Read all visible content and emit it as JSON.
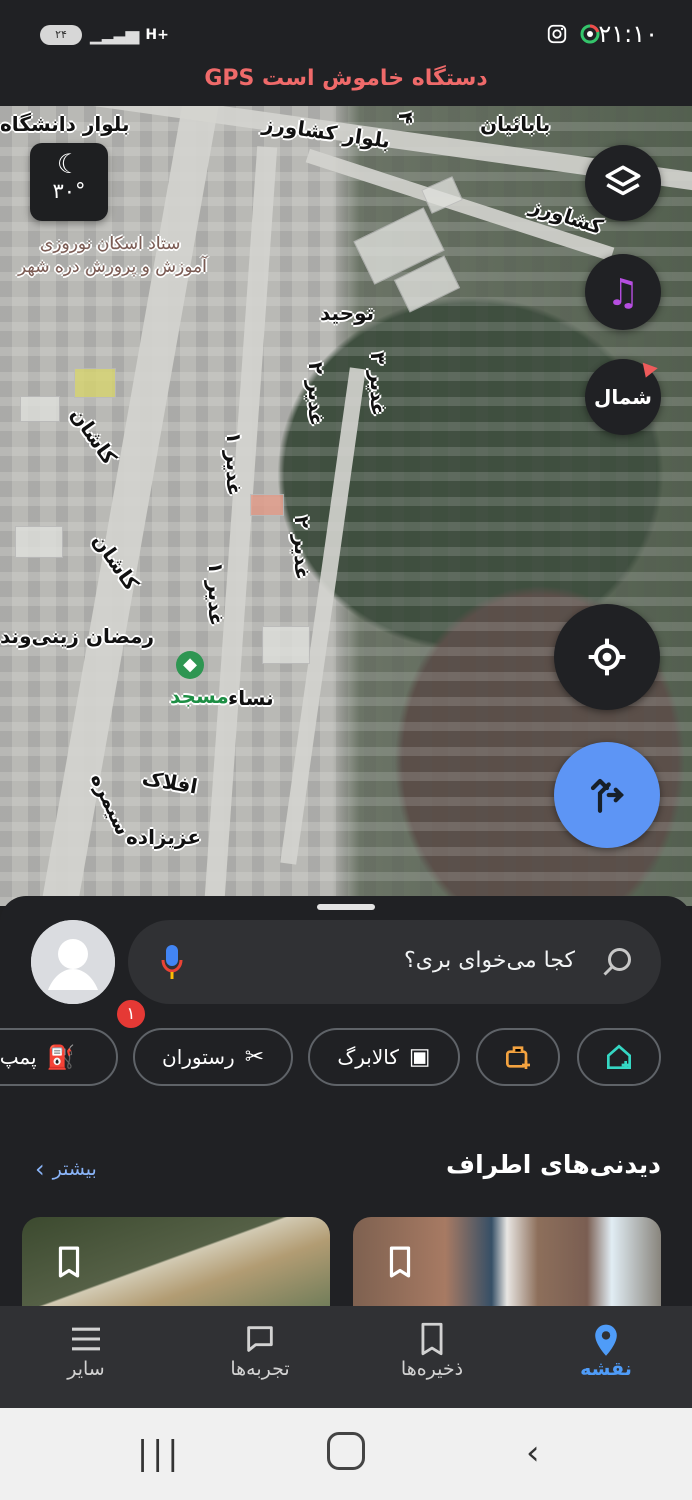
{
  "status_bar": {
    "time": "۲۱:۱۰",
    "network_pill": "۲۴",
    "network_type": "H+",
    "icons": [
      "instagram-icon",
      "activity-ring-icon",
      "signal-icon"
    ]
  },
  "gps_banner": "GPS دستگاه خاموش است",
  "map": {
    "weather_temp": "۳۰°",
    "weather_icon": "moon-stars-icon",
    "labels": {
      "university_blvd": "بلوار دانشگاه",
      "keshavarz_blvd": "بلوار کشاورز",
      "babaeian": "بابائیان",
      "keshavarz": "کشاورز",
      "setad_line1": "ستاد اسکان نوروزی",
      "setad_line2": "آموزش و پرورش دره شهر",
      "tohid": "توحید",
      "ghadir3": "غدیر ۳",
      "ghadir2a": "غدیر ۲",
      "ghadir1a": "غدیر ۱",
      "ghadir2b": "غدیر ۲",
      "ghadir1b": "غدیر ۱",
      "kashan1": "کاشان",
      "kashan2": "کاشان",
      "ramezan": "رمضان زینی‌وند",
      "nesa": "نساء",
      "mosque": "مسجد",
      "aflak": "افلاک",
      "simreh": "سیمره",
      "azizadeh": "عزیزاده",
      "right_top": "۴"
    },
    "north_label": "شمال"
  },
  "search": {
    "placeholder": "کجا می‌خوای بری؟",
    "notification_count": "۱"
  },
  "chips": {
    "work_icon": "briefcase-plus-icon",
    "home_icon": "home-plus-icon",
    "ticket": "کالابرگ",
    "restaurant": "رستوران",
    "gas": "پمپ بنزین"
  },
  "nearby": {
    "title": "دیدنی‌های اطراف",
    "more": "بیشتر"
  },
  "bottom_nav": {
    "map": "نقشه",
    "saved": "ذخیره‌ها",
    "contributions": "تجربه‌ها",
    "more": "سایر"
  },
  "system_nav": {
    "recent": "recent-apps-icon",
    "home": "home-button-icon",
    "back": "back-button-icon"
  }
}
